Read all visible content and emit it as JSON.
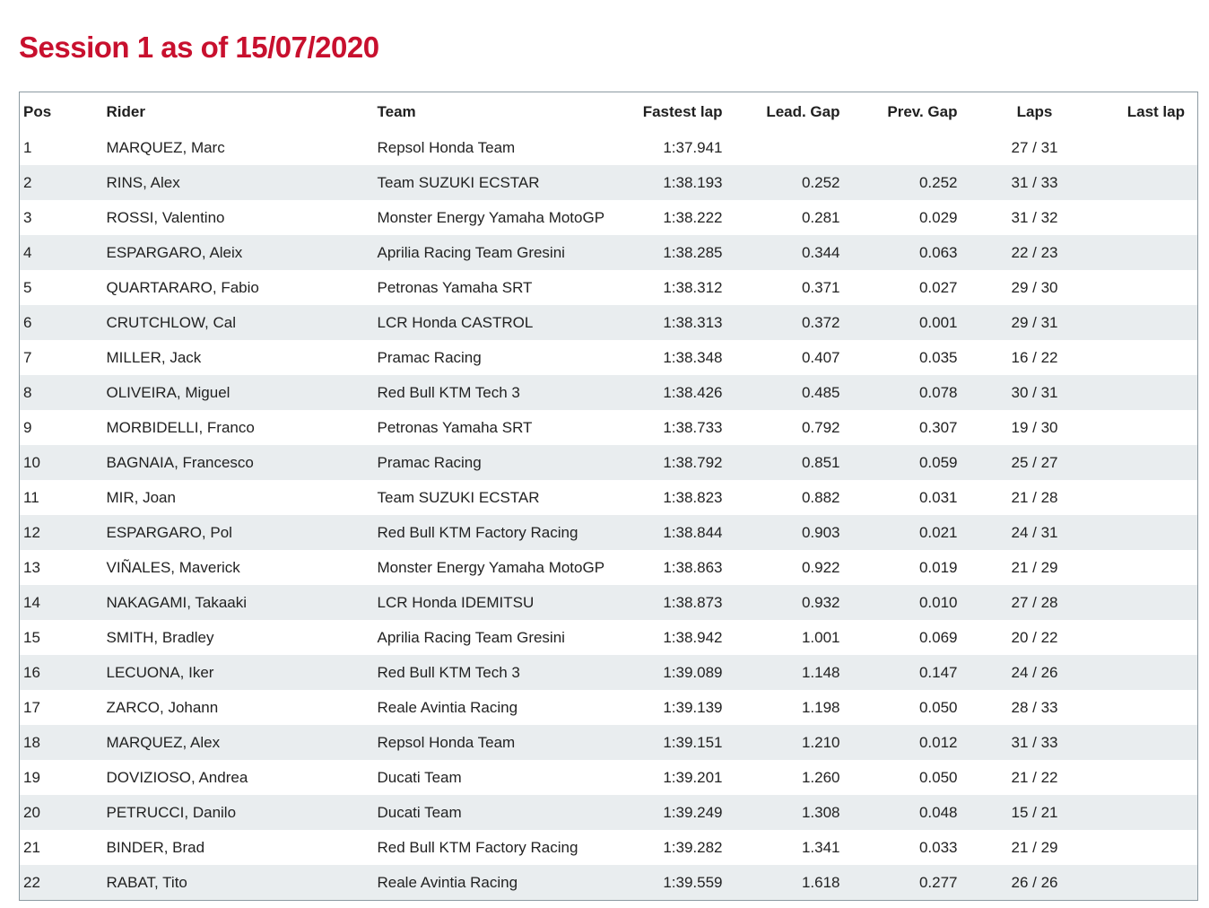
{
  "page": {
    "title": "Session 1 as of 15/07/2020"
  },
  "table": {
    "headers": {
      "pos": "Pos",
      "rider": "Rider",
      "team": "Team",
      "fastest_lap": "Fastest lap",
      "lead_gap": "Lead. Gap",
      "prev_gap": "Prev. Gap",
      "laps": "Laps",
      "last_lap": "Last lap"
    },
    "rows": [
      {
        "pos": "1",
        "rider": "MARQUEZ, Marc",
        "team": "Repsol Honda Team",
        "fastest_lap": "1:37.941",
        "lead_gap": "",
        "prev_gap": "",
        "laps": "27 / 31",
        "last_lap": ""
      },
      {
        "pos": "2",
        "rider": "RINS, Alex",
        "team": "Team SUZUKI ECSTAR",
        "fastest_lap": "1:38.193",
        "lead_gap": "0.252",
        "prev_gap": "0.252",
        "laps": "31 / 33",
        "last_lap": ""
      },
      {
        "pos": "3",
        "rider": "ROSSI, Valentino",
        "team": "Monster Energy Yamaha MotoGP",
        "fastest_lap": "1:38.222",
        "lead_gap": "0.281",
        "prev_gap": "0.029",
        "laps": "31 / 32",
        "last_lap": ""
      },
      {
        "pos": "4",
        "rider": "ESPARGARO, Aleix",
        "team": "Aprilia Racing Team Gresini",
        "fastest_lap": "1:38.285",
        "lead_gap": "0.344",
        "prev_gap": "0.063",
        "laps": "22 / 23",
        "last_lap": ""
      },
      {
        "pos": "5",
        "rider": "QUARTARARO, Fabio",
        "team": "Petronas Yamaha SRT",
        "fastest_lap": "1:38.312",
        "lead_gap": "0.371",
        "prev_gap": "0.027",
        "laps": "29 / 30",
        "last_lap": ""
      },
      {
        "pos": "6",
        "rider": "CRUTCHLOW, Cal",
        "team": "LCR Honda CASTROL",
        "fastest_lap": "1:38.313",
        "lead_gap": "0.372",
        "prev_gap": "0.001",
        "laps": "29 / 31",
        "last_lap": ""
      },
      {
        "pos": "7",
        "rider": "MILLER, Jack",
        "team": "Pramac Racing",
        "fastest_lap": "1:38.348",
        "lead_gap": "0.407",
        "prev_gap": "0.035",
        "laps": "16 / 22",
        "last_lap": ""
      },
      {
        "pos": "8",
        "rider": "OLIVEIRA, Miguel",
        "team": "Red Bull KTM Tech 3",
        "fastest_lap": "1:38.426",
        "lead_gap": "0.485",
        "prev_gap": "0.078",
        "laps": "30 / 31",
        "last_lap": ""
      },
      {
        "pos": "9",
        "rider": "MORBIDELLI, Franco",
        "team": "Petronas Yamaha SRT",
        "fastest_lap": "1:38.733",
        "lead_gap": "0.792",
        "prev_gap": "0.307",
        "laps": "19 / 30",
        "last_lap": ""
      },
      {
        "pos": "10",
        "rider": "BAGNAIA, Francesco",
        "team": "Pramac Racing",
        "fastest_lap": "1:38.792",
        "lead_gap": "0.851",
        "prev_gap": "0.059",
        "laps": "25 / 27",
        "last_lap": ""
      },
      {
        "pos": "11",
        "rider": "MIR, Joan",
        "team": "Team SUZUKI ECSTAR",
        "fastest_lap": "1:38.823",
        "lead_gap": "0.882",
        "prev_gap": "0.031",
        "laps": "21 / 28",
        "last_lap": ""
      },
      {
        "pos": "12",
        "rider": "ESPARGARO, Pol",
        "team": "Red Bull KTM Factory Racing",
        "fastest_lap": "1:38.844",
        "lead_gap": "0.903",
        "prev_gap": "0.021",
        "laps": "24 / 31",
        "last_lap": ""
      },
      {
        "pos": "13",
        "rider": "VIÑALES, Maverick",
        "team": "Monster Energy Yamaha MotoGP",
        "fastest_lap": "1:38.863",
        "lead_gap": "0.922",
        "prev_gap": "0.019",
        "laps": "21 / 29",
        "last_lap": ""
      },
      {
        "pos": "14",
        "rider": "NAKAGAMI, Takaaki",
        "team": "LCR Honda IDEMITSU",
        "fastest_lap": "1:38.873",
        "lead_gap": "0.932",
        "prev_gap": "0.010",
        "laps": "27 / 28",
        "last_lap": ""
      },
      {
        "pos": "15",
        "rider": "SMITH, Bradley",
        "team": "Aprilia Racing Team Gresini",
        "fastest_lap": "1:38.942",
        "lead_gap": "1.001",
        "prev_gap": "0.069",
        "laps": "20 / 22",
        "last_lap": ""
      },
      {
        "pos": "16",
        "rider": "LECUONA, Iker",
        "team": "Red Bull KTM Tech 3",
        "fastest_lap": "1:39.089",
        "lead_gap": "1.148",
        "prev_gap": "0.147",
        "laps": "24 / 26",
        "last_lap": ""
      },
      {
        "pos": "17",
        "rider": "ZARCO, Johann",
        "team": "Reale Avintia Racing",
        "fastest_lap": "1:39.139",
        "lead_gap": "1.198",
        "prev_gap": "0.050",
        "laps": "28 / 33",
        "last_lap": ""
      },
      {
        "pos": "18",
        "rider": "MARQUEZ, Alex",
        "team": "Repsol Honda Team",
        "fastest_lap": "1:39.151",
        "lead_gap": "1.210",
        "prev_gap": "0.012",
        "laps": "31 / 33",
        "last_lap": ""
      },
      {
        "pos": "19",
        "rider": "DOVIZIOSO, Andrea",
        "team": "Ducati Team",
        "fastest_lap": "1:39.201",
        "lead_gap": "1.260",
        "prev_gap": "0.050",
        "laps": "21 / 22",
        "last_lap": ""
      },
      {
        "pos": "20",
        "rider": "PETRUCCI, Danilo",
        "team": "Ducati Team",
        "fastest_lap": "1:39.249",
        "lead_gap": "1.308",
        "prev_gap": "0.048",
        "laps": "15 / 21",
        "last_lap": ""
      },
      {
        "pos": "21",
        "rider": "BINDER, Brad",
        "team": "Red Bull KTM Factory Racing",
        "fastest_lap": "1:39.282",
        "lead_gap": "1.341",
        "prev_gap": "0.033",
        "laps": "21 / 29",
        "last_lap": ""
      },
      {
        "pos": "22",
        "rider": "RABAT, Tito",
        "team": "Reale Avintia Racing",
        "fastest_lap": "1:39.559",
        "lead_gap": "1.618",
        "prev_gap": "0.277",
        "laps": "26 / 26",
        "last_lap": ""
      }
    ]
  },
  "colors": {
    "title": "#c8102e",
    "stripe": "#e9edef",
    "border": "#8c9aa2"
  }
}
